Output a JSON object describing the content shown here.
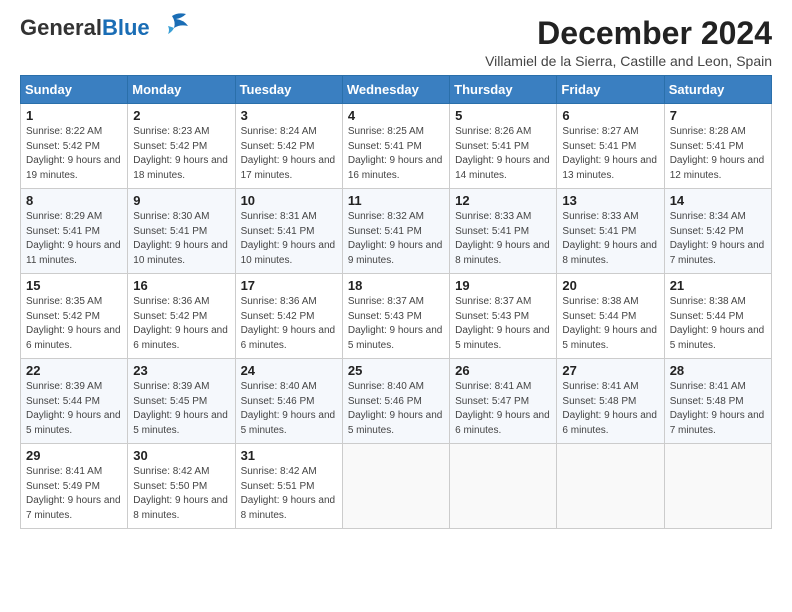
{
  "header": {
    "logo_general": "General",
    "logo_blue": "Blue",
    "month_title": "December 2024",
    "location": "Villamiel de la Sierra, Castille and Leon, Spain"
  },
  "days_of_week": [
    "Sunday",
    "Monday",
    "Tuesday",
    "Wednesday",
    "Thursday",
    "Friday",
    "Saturday"
  ],
  "weeks": [
    [
      {
        "num": "1",
        "sunrise": "8:22 AM",
        "sunset": "5:42 PM",
        "daylight": "9 hours and 19 minutes."
      },
      {
        "num": "2",
        "sunrise": "8:23 AM",
        "sunset": "5:42 PM",
        "daylight": "9 hours and 18 minutes."
      },
      {
        "num": "3",
        "sunrise": "8:24 AM",
        "sunset": "5:42 PM",
        "daylight": "9 hours and 17 minutes."
      },
      {
        "num": "4",
        "sunrise": "8:25 AM",
        "sunset": "5:41 PM",
        "daylight": "9 hours and 16 minutes."
      },
      {
        "num": "5",
        "sunrise": "8:26 AM",
        "sunset": "5:41 PM",
        "daylight": "9 hours and 14 minutes."
      },
      {
        "num": "6",
        "sunrise": "8:27 AM",
        "sunset": "5:41 PM",
        "daylight": "9 hours and 13 minutes."
      },
      {
        "num": "7",
        "sunrise": "8:28 AM",
        "sunset": "5:41 PM",
        "daylight": "9 hours and 12 minutes."
      }
    ],
    [
      {
        "num": "8",
        "sunrise": "8:29 AM",
        "sunset": "5:41 PM",
        "daylight": "9 hours and 11 minutes."
      },
      {
        "num": "9",
        "sunrise": "8:30 AM",
        "sunset": "5:41 PM",
        "daylight": "9 hours and 10 minutes."
      },
      {
        "num": "10",
        "sunrise": "8:31 AM",
        "sunset": "5:41 PM",
        "daylight": "9 hours and 10 minutes."
      },
      {
        "num": "11",
        "sunrise": "8:32 AM",
        "sunset": "5:41 PM",
        "daylight": "9 hours and 9 minutes."
      },
      {
        "num": "12",
        "sunrise": "8:33 AM",
        "sunset": "5:41 PM",
        "daylight": "9 hours and 8 minutes."
      },
      {
        "num": "13",
        "sunrise": "8:33 AM",
        "sunset": "5:41 PM",
        "daylight": "9 hours and 8 minutes."
      },
      {
        "num": "14",
        "sunrise": "8:34 AM",
        "sunset": "5:42 PM",
        "daylight": "9 hours and 7 minutes."
      }
    ],
    [
      {
        "num": "15",
        "sunrise": "8:35 AM",
        "sunset": "5:42 PM",
        "daylight": "9 hours and 6 minutes."
      },
      {
        "num": "16",
        "sunrise": "8:36 AM",
        "sunset": "5:42 PM",
        "daylight": "9 hours and 6 minutes."
      },
      {
        "num": "17",
        "sunrise": "8:36 AM",
        "sunset": "5:42 PM",
        "daylight": "9 hours and 6 minutes."
      },
      {
        "num": "18",
        "sunrise": "8:37 AM",
        "sunset": "5:43 PM",
        "daylight": "9 hours and 5 minutes."
      },
      {
        "num": "19",
        "sunrise": "8:37 AM",
        "sunset": "5:43 PM",
        "daylight": "9 hours and 5 minutes."
      },
      {
        "num": "20",
        "sunrise": "8:38 AM",
        "sunset": "5:44 PM",
        "daylight": "9 hours and 5 minutes."
      },
      {
        "num": "21",
        "sunrise": "8:38 AM",
        "sunset": "5:44 PM",
        "daylight": "9 hours and 5 minutes."
      }
    ],
    [
      {
        "num": "22",
        "sunrise": "8:39 AM",
        "sunset": "5:44 PM",
        "daylight": "9 hours and 5 minutes."
      },
      {
        "num": "23",
        "sunrise": "8:39 AM",
        "sunset": "5:45 PM",
        "daylight": "9 hours and 5 minutes."
      },
      {
        "num": "24",
        "sunrise": "8:40 AM",
        "sunset": "5:46 PM",
        "daylight": "9 hours and 5 minutes."
      },
      {
        "num": "25",
        "sunrise": "8:40 AM",
        "sunset": "5:46 PM",
        "daylight": "9 hours and 5 minutes."
      },
      {
        "num": "26",
        "sunrise": "8:41 AM",
        "sunset": "5:47 PM",
        "daylight": "9 hours and 6 minutes."
      },
      {
        "num": "27",
        "sunrise": "8:41 AM",
        "sunset": "5:48 PM",
        "daylight": "9 hours and 6 minutes."
      },
      {
        "num": "28",
        "sunrise": "8:41 AM",
        "sunset": "5:48 PM",
        "daylight": "9 hours and 7 minutes."
      }
    ],
    [
      {
        "num": "29",
        "sunrise": "8:41 AM",
        "sunset": "5:49 PM",
        "daylight": "9 hours and 7 minutes."
      },
      {
        "num": "30",
        "sunrise": "8:42 AM",
        "sunset": "5:50 PM",
        "daylight": "9 hours and 8 minutes."
      },
      {
        "num": "31",
        "sunrise": "8:42 AM",
        "sunset": "5:51 PM",
        "daylight": "9 hours and 8 minutes."
      },
      null,
      null,
      null,
      null
    ]
  ],
  "labels": {
    "sunrise": "Sunrise:",
    "sunset": "Sunset:",
    "daylight": "Daylight:"
  }
}
